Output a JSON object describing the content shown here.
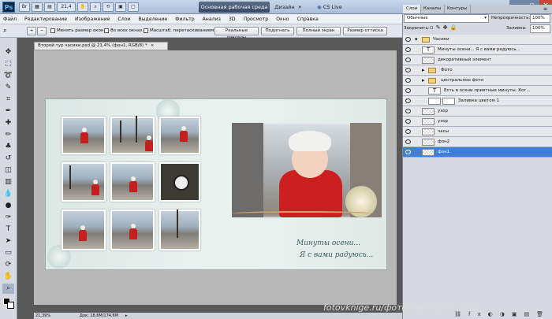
{
  "app": {
    "logo": "Ps",
    "zoom": "21,4",
    "workspace_main": "Основная рабочая среда",
    "workspace_design": "Дизайн",
    "cslive": "CS Live"
  },
  "menu": [
    "Файл",
    "Редактирование",
    "Изображение",
    "Слои",
    "Выделение",
    "Фильтр",
    "Анализ",
    "3D",
    "Просмотр",
    "Окно",
    "Справка"
  ],
  "options": {
    "resize_windows": "Менять размер окон",
    "all_windows": "Во всех окнах",
    "scrubby": "Масштаб. перетаскиванием",
    "actual_pixels": "Реальные пикселы",
    "fit_screen": "Подогнать",
    "full_screen": "Полный экран",
    "print_size": "Размер оттиска"
  },
  "document": {
    "tab_title": "Второй тур часики.psd @ 21,4% (фон1, RGB/8) *",
    "zoom_status": "21,39%",
    "doc_size": "Док: 18,6М/174,6М"
  },
  "artwork_text": {
    "line1": "Минуты осени...",
    "line2": "Я с вами радуюсь..."
  },
  "panels": {
    "tabs": [
      "Слои",
      "Каналы",
      "Контуры"
    ],
    "blend_mode": "Обычные",
    "opacity_label": "Непрозрачность:",
    "opacity": "100%",
    "lock_label": "Закрепить:",
    "fill_label": "Заливка:",
    "fill": "100%"
  },
  "layers": [
    {
      "name": "Часики",
      "kind": "group",
      "selected": false
    },
    {
      "name": "Минуты осени... Я с вами радуюсь...",
      "kind": "text",
      "selected": false
    },
    {
      "name": "декоративный элемент",
      "kind": "layer",
      "selected": false
    },
    {
      "name": "Фото",
      "kind": "group",
      "selected": false
    },
    {
      "name": "центральное фото",
      "kind": "group",
      "selected": false
    },
    {
      "name": "Есть в осени приятные минуты. Ког...",
      "kind": "text",
      "selected": false
    },
    {
      "name": "Заливка цветом 1",
      "kind": "fill",
      "selected": false
    },
    {
      "name": "узор",
      "kind": "layer",
      "selected": false
    },
    {
      "name": "узор",
      "kind": "layer",
      "selected": false
    },
    {
      "name": "часы",
      "kind": "layer",
      "selected": false
    },
    {
      "name": "фон2",
      "kind": "layer",
      "selected": false
    },
    {
      "name": "фон1",
      "kind": "layer",
      "selected": true
    }
  ],
  "watermark": "fotovknige.ru/фотокниги для души",
  "colors": {
    "accent": "#3f7fd9",
    "workspace_btn": "#34465f",
    "canvas_bg": "#595959"
  }
}
